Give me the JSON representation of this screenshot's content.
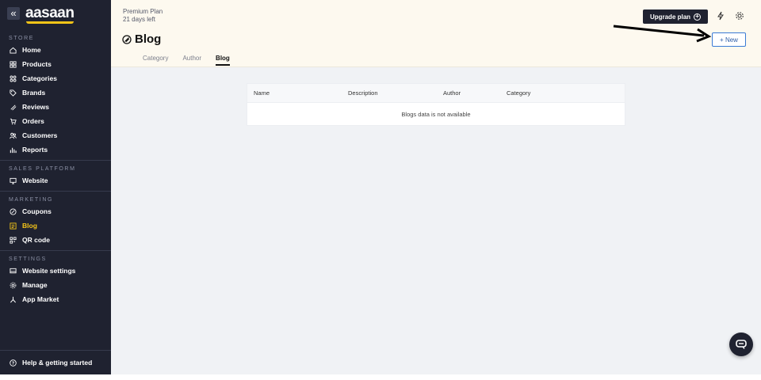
{
  "brand": {
    "collapse_glyph": "«",
    "logo_text": "aasaan",
    "accent": "#f5c518"
  },
  "sidebar": {
    "sections": [
      {
        "label": "STORE",
        "items": [
          {
            "label": "Home",
            "icon": "home-icon"
          },
          {
            "label": "Products",
            "icon": "products-icon"
          },
          {
            "label": "Categories",
            "icon": "categories-icon"
          },
          {
            "label": "Brands",
            "icon": "tag-icon"
          },
          {
            "label": "Reviews",
            "icon": "reviews-icon"
          },
          {
            "label": "Orders",
            "icon": "cart-icon"
          },
          {
            "label": "Customers",
            "icon": "customers-icon"
          },
          {
            "label": "Reports",
            "icon": "chart-icon"
          }
        ]
      },
      {
        "label": "SALES PLATFORM",
        "items": [
          {
            "label": "Website",
            "icon": "monitor-icon"
          }
        ]
      },
      {
        "label": "MARKETING",
        "items": [
          {
            "label": "Coupons",
            "icon": "coupon-icon"
          },
          {
            "label": "Blog",
            "icon": "blog-icon",
            "active": true
          },
          {
            "label": "QR code",
            "icon": "qr-icon"
          }
        ]
      },
      {
        "label": "SETTINGS",
        "items": [
          {
            "label": "Website settings",
            "icon": "website-settings-icon"
          },
          {
            "label": "Manage",
            "icon": "gear-icon"
          },
          {
            "label": "App Market",
            "icon": "app-market-icon"
          }
        ]
      }
    ],
    "footer": {
      "label": "Help & getting started",
      "icon": "help-icon"
    }
  },
  "header": {
    "plan_name": "Premium Plan",
    "plan_remaining": "21 days left",
    "title": "Blog",
    "tabs": [
      "Category",
      "Author",
      "Blog"
    ],
    "active_tab": "Blog",
    "upgrade_label": "Upgrade plan",
    "new_label": "+ New"
  },
  "table": {
    "columns": [
      "Name",
      "Description",
      "Author",
      "Category"
    ],
    "empty_message": "Blogs data is not available"
  },
  "colors": {
    "sidebar_bg": "#1f2230",
    "header_bg": "#fdf9ef",
    "main_bg": "#f0f2f5",
    "link_blue": "#2d5ea8"
  }
}
